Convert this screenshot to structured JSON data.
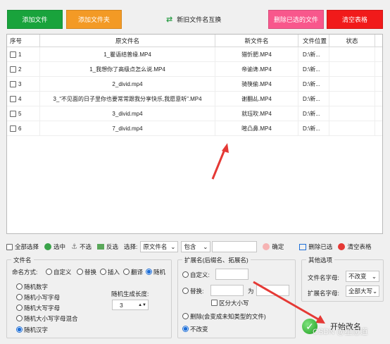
{
  "toolbar": {
    "add_file": "添加文件",
    "add_folder": "添加文件夹",
    "swap_names": "新旧文件名互换",
    "delete_selected": "删除已选的文件",
    "clear_table": "清空表格",
    "colors": {
      "green": "#19a33c",
      "orange": "#f39a25",
      "pink": "#f8578c",
      "red": "#f11a1a"
    }
  },
  "table": {
    "columns": [
      "序号",
      "原文件名",
      "新文件名",
      "文件位置",
      "状态"
    ],
    "rows": [
      {
        "index": "1",
        "original": "1_瞿语结普缘.MP4",
        "new": "猎忻肥.MP4",
        "location": "D:\\新...",
        "status": ""
      },
      {
        "index": "2",
        "original": "1_我想你了高级点怎么说.MP4",
        "new": "帝谕谗.MP4",
        "location": "D:\\新...",
        "status": ""
      },
      {
        "index": "3",
        "original": "2_divid.mp4",
        "new": "骑筷偷.MP4",
        "location": "D:\\新...",
        "status": ""
      },
      {
        "index": "4",
        "original": "3_“不见面的日子里你也要常常跟我分享快乐,我愿意听”.MP4",
        "new": "谢翻乩.MP4",
        "location": "D:\\新...",
        "status": ""
      },
      {
        "index": "5",
        "original": "3_divid.mp4",
        "new": "就珏吹.MP4",
        "location": "D:\\新...",
        "status": ""
      },
      {
        "index": "6",
        "original": "7_divid.mp4",
        "new": "嘧凸鼻.MP4",
        "location": "D:\\新...",
        "status": ""
      }
    ]
  },
  "select_bar": {
    "select_all": "全部选择",
    "select": "选中",
    "deselect": "不选",
    "invert": "反选",
    "choose_label": "选择:",
    "field_value": "原文件名",
    "match_value": "包含",
    "confirm": "确定",
    "delete_selected": "删除已选",
    "clear_table": "清空表格"
  },
  "filename": {
    "group_title": "文件名",
    "mode_label": "命名方式:",
    "modes": [
      "自定义",
      "替换",
      "插入",
      "翻译",
      "随机"
    ],
    "random_options": [
      "随机数字",
      "随机小写字母",
      "随机大写字母",
      "随机大小写字母混合",
      "随机汉字"
    ],
    "length_label": "随机生成长度:",
    "length_value": "3"
  },
  "extension": {
    "group_title": "扩展名(后缀名、拓展名)",
    "custom": "自定义:",
    "replace": "替换:",
    "to": "为",
    "case_sensitive": "区分大小写",
    "delete": "删除(会变成未知类型的文件)",
    "no_change": "不改变"
  },
  "other": {
    "group_title": "其他选项",
    "filename_case_label": "文件名字母:",
    "filename_case_value": "不改变",
    "ext_case_label": "扩展名字母:",
    "ext_case_value": "全部大写"
  },
  "start": {
    "label": "开始改名"
  },
  "watermark": "CSDN @星愿道"
}
